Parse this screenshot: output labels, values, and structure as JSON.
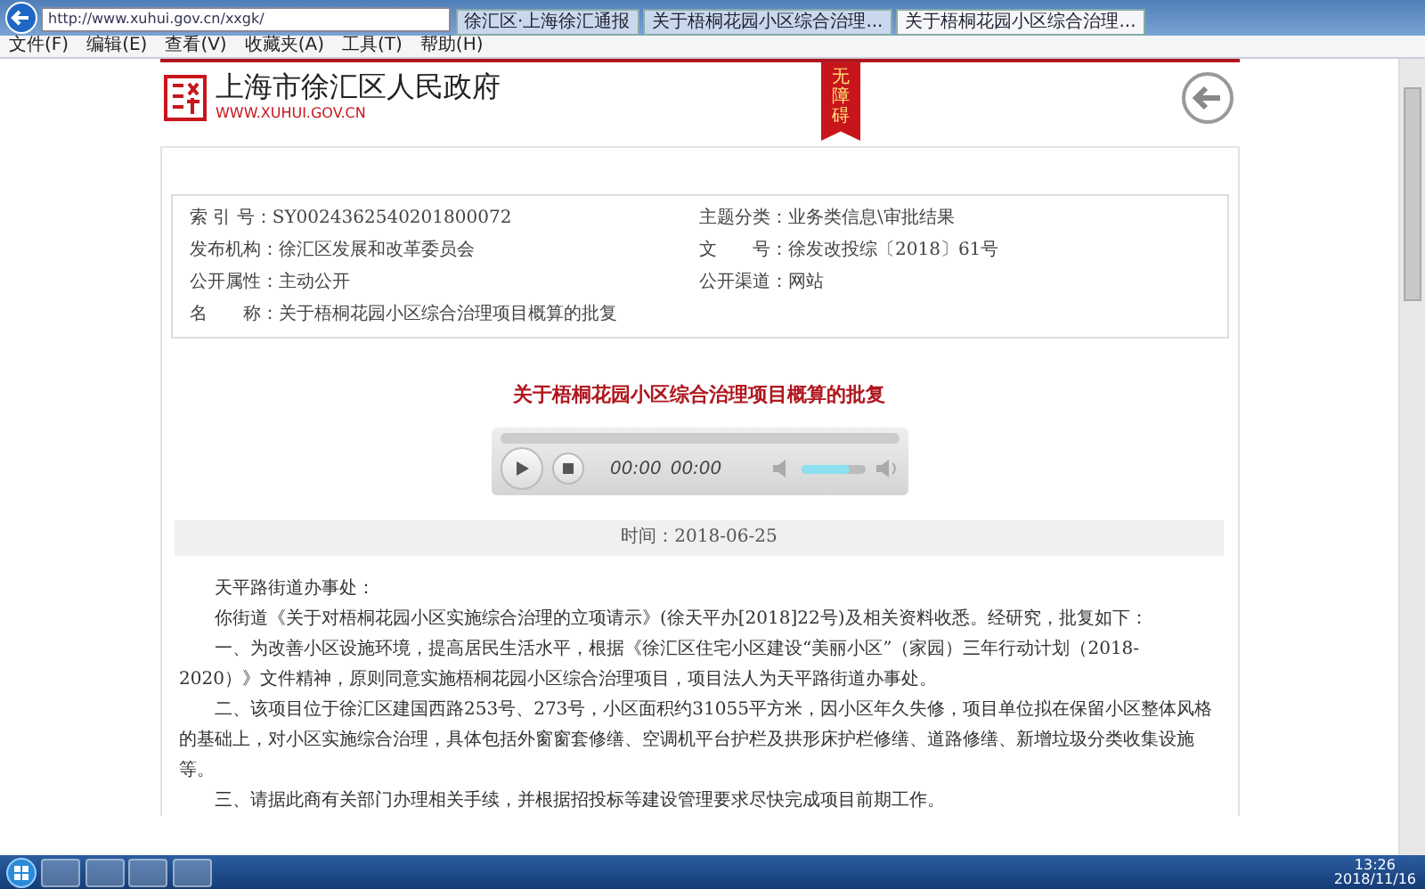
{
  "browser": {
    "url": "http://www.xuhui.gov.cn/xxgk/",
    "tabs": [
      {
        "label": "徐汇区·上海徐汇通报",
        "selected": false
      },
      {
        "label": "关于梧桐花园小区综合治理...",
        "selected": false
      },
      {
        "label": "关于梧桐花园小区综合治理...",
        "selected": true
      }
    ],
    "menu": [
      "文件(F)",
      "编辑(E)",
      "查看(V)",
      "收藏夹(A)",
      "工具(T)",
      "帮助(H)"
    ]
  },
  "header": {
    "site_name": "上海市徐汇区人民政府",
    "site_url": "WWW.XUHUI.GOV.CN",
    "ribbon": "无障碍"
  },
  "info": [
    {
      "label": "索 引 号：",
      "value": "SY0024362540201800072"
    },
    {
      "label": "主题分类：",
      "value": "业务类信息\\审批结果"
    },
    {
      "label": "发布机构：",
      "value": "徐汇区发展和改革委员会"
    },
    {
      "label": "文　　号：",
      "value": "徐发改投综〔2018〕61号"
    },
    {
      "label": "公开属性：",
      "value": "主动公开"
    },
    {
      "label": "公开渠道：",
      "value": "网站"
    },
    {
      "label": "名　　称：",
      "value": "关于梧桐花园小区综合治理项目概算的批复"
    }
  ],
  "article": {
    "title": "关于梧桐花园小区综合治理项目概算的批复",
    "player": {
      "elapsed": "00:00",
      "duration": "00:00",
      "volume": {
        "level": 0.75
      }
    },
    "date": "时间：2018-06-25",
    "paragraphs": [
      "天平路街道办事处：",
      "你街道《关于对梧桐花园小区实施综合治理的立项请示》(徐天平办[2018]22号)及相关资料收悉。经研究，批复如下：",
      "一、为改善小区设施环境，提高居民生活水平，根据《徐汇区住宅小区建设“美丽小区”（家园）三年行动计划（2018-2020）》文件精神，原则同意实施梧桐花园小区综合治理项目，项目法人为天平路街道办事处。",
      "二、该项目位于徐汇区建国西路253号、273号，小区面积约31055平方米，因小区年久失修，项目单位拟在保留小区整体风格的基础上，对小区实施综合治理，具体包括外窗窗套修缮、空调机平台护栏及拱形床护栏修缮、道路修缮、新增垃圾分类收集设施等。",
      "三、请据此商有关部门办理相关手续，并根据招投标等建设管理要求尽快完成项目前期工作。"
    ]
  },
  "taskbar": {
    "time": "13:26",
    "date": "2018/11/16"
  }
}
